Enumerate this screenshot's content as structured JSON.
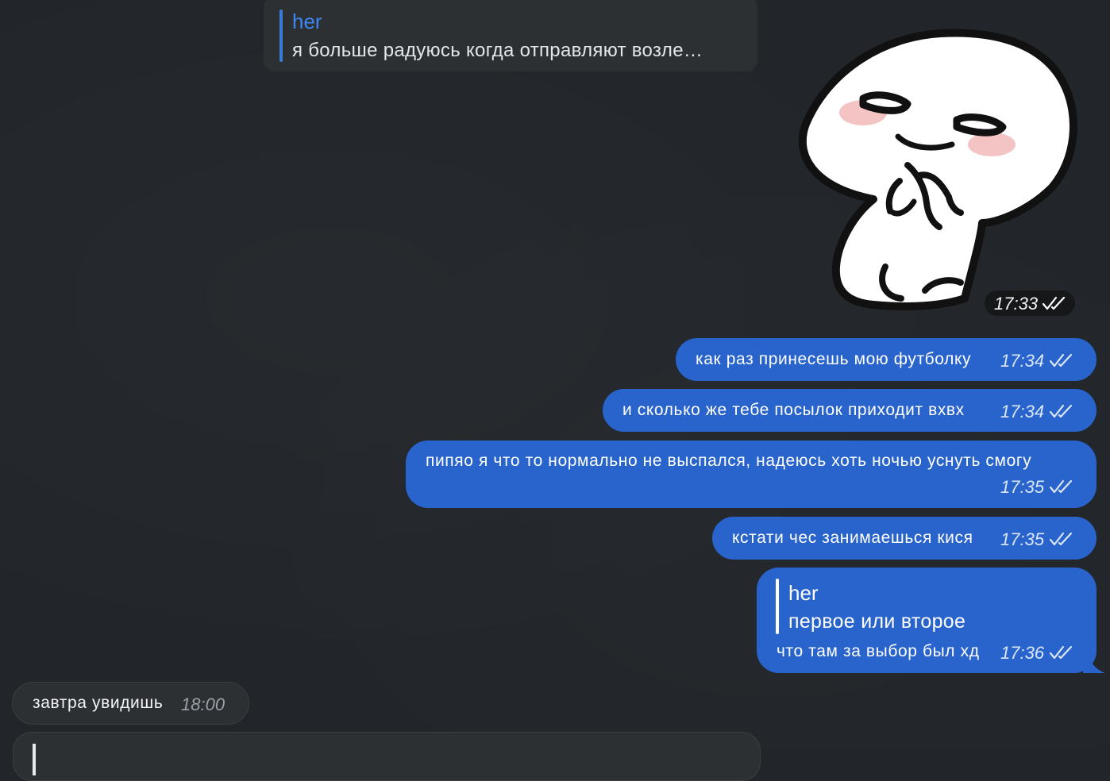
{
  "top_reply": {
    "author": "her",
    "quote": "я больше радуюсь когда отправляют возле…"
  },
  "sticker": {
    "time": "17:33"
  },
  "outgoing": [
    {
      "text": "как раз принесешь мою футболку",
      "time": "17:34"
    },
    {
      "text": "и сколько же тебе посылок приходит вхвх",
      "time": "17:34"
    },
    {
      "text": "пипяо я что то нормально не выспался, надеюсь хоть ночью уснуть смогу",
      "time": "17:35"
    },
    {
      "text": "кстати чес занимаешься кися",
      "time": "17:35"
    }
  ],
  "reply_message": {
    "author": "her",
    "quote": "первое или второе",
    "text": "что там за выбор был хд",
    "time": "17:36"
  },
  "incoming": {
    "text": "завтра увидишь",
    "time": "18:00"
  },
  "colors": {
    "background": "#22262a",
    "outgoing_bubble": "#2864cc",
    "incoming_bubble": "#2d3033",
    "reply_author_accent": "#3e86f0"
  }
}
